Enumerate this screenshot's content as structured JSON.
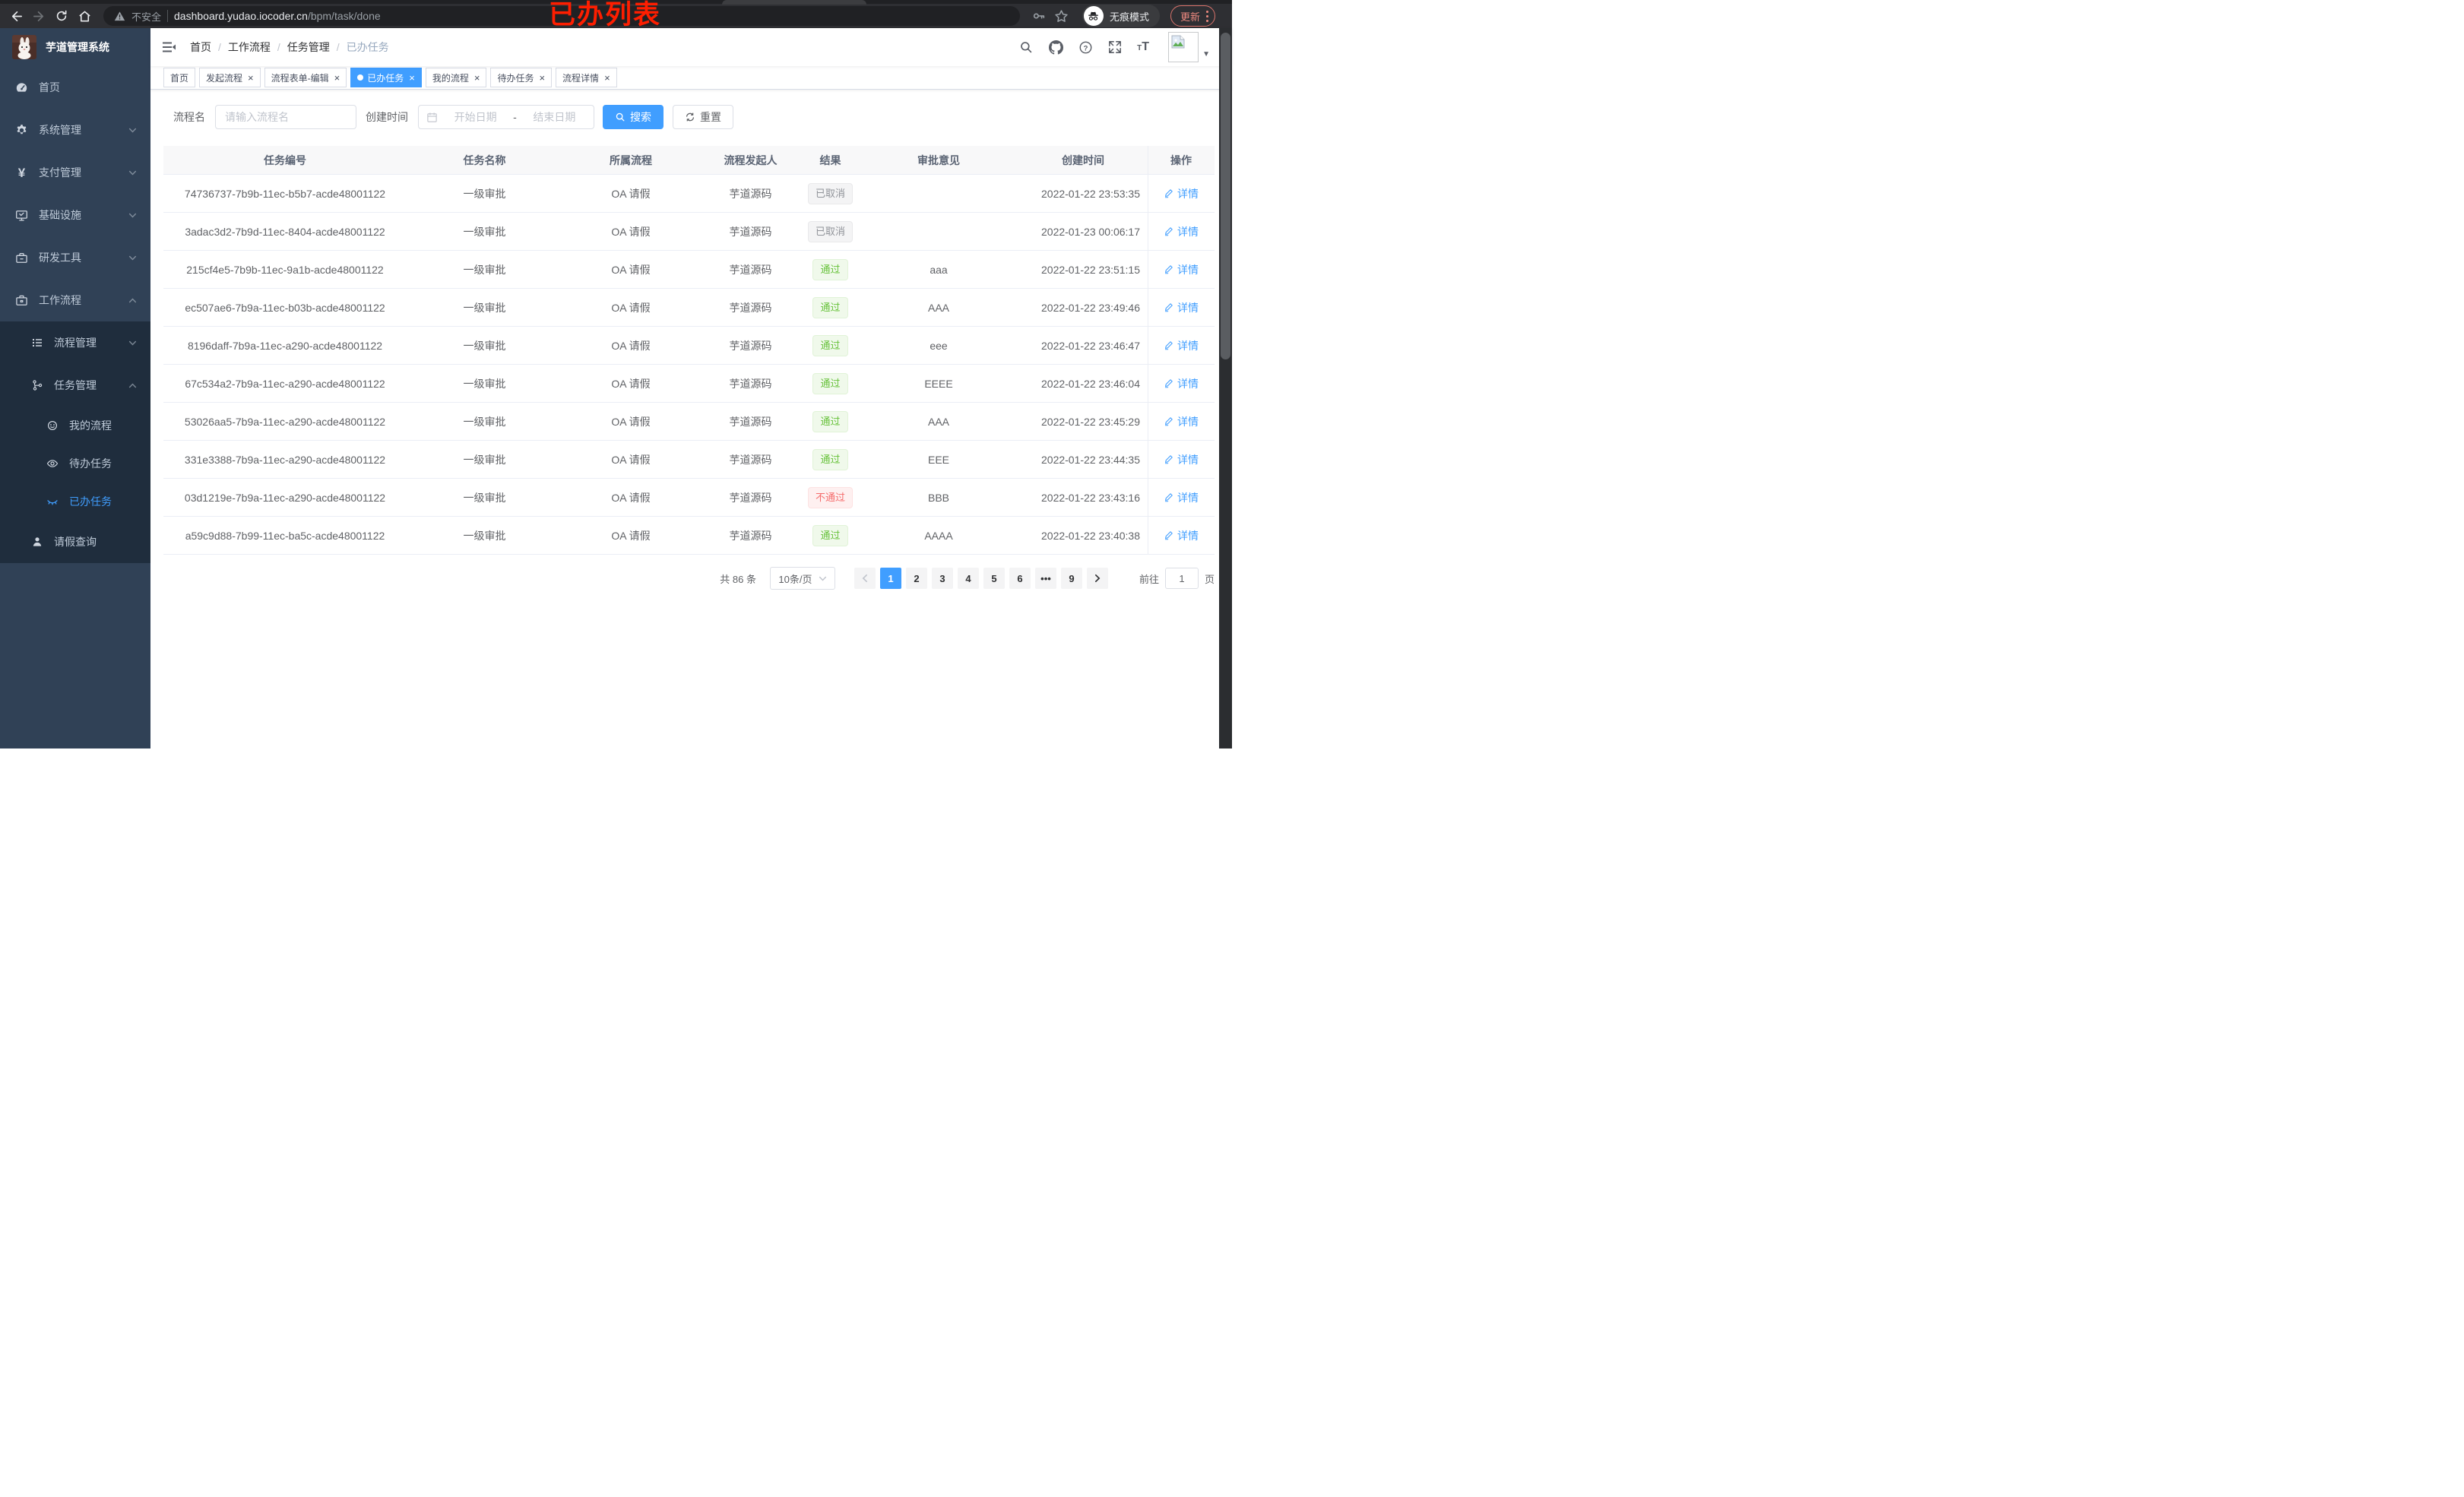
{
  "ui": {
    "close_glyph": "×",
    "breadcrumb_separator": "/",
    "caret_glyph": "▼"
  },
  "annotation": {
    "text": "已办列表"
  },
  "browser": {
    "security_label": "不安全",
    "url_host": "dashboard.yudao.iocoder.cn",
    "url_path": "/bpm/task/done",
    "incognito_label": "无痕模式",
    "update_label": "更新"
  },
  "sidebar": {
    "app_title": "芋道管理系统",
    "items": [
      {
        "label": "首页",
        "icon": "dashboard-icon"
      },
      {
        "label": "系统管理",
        "icon": "gear-icon"
      },
      {
        "label": "支付管理",
        "icon": "yen-icon"
      },
      {
        "label": "基础设施",
        "icon": "monitor-icon"
      },
      {
        "label": "研发工具",
        "icon": "toolbox-icon"
      },
      {
        "label": "工作流程",
        "icon": "briefcase-icon"
      }
    ],
    "submenu": [
      {
        "label": "流程管理",
        "icon": "list-icon"
      },
      {
        "label": "任务管理",
        "icon": "flow-icon"
      }
    ],
    "task_children": [
      {
        "label": "我的流程",
        "icon": "user-face-icon"
      },
      {
        "label": "待办任务",
        "icon": "eye-open-icon"
      },
      {
        "label": "已办任务",
        "icon": "eye-closed-icon",
        "active": true
      }
    ],
    "leave_query": {
      "label": "请假查询",
      "icon": "person-icon"
    }
  },
  "breadcrumb": {
    "items": [
      "首页",
      "工作流程",
      "任务管理",
      "已办任务"
    ]
  },
  "tabs": [
    {
      "label": "首页",
      "closable": false,
      "active": false
    },
    {
      "label": "发起流程",
      "closable": true,
      "active": false
    },
    {
      "label": "流程表单-编辑",
      "closable": true,
      "active": false
    },
    {
      "label": "已办任务",
      "closable": true,
      "active": true
    },
    {
      "label": "我的流程",
      "closable": true,
      "active": false
    },
    {
      "label": "待办任务",
      "closable": true,
      "active": false
    },
    {
      "label": "流程详情",
      "closable": true,
      "active": false
    }
  ],
  "filters": {
    "name_label": "流程名",
    "name_placeholder": "请输入流程名",
    "time_label": "创建时间",
    "start_placeholder": "开始日期",
    "range_separator": "-",
    "end_placeholder": "结束日期",
    "search_label": "搜索",
    "reset_label": "重置"
  },
  "table": {
    "columns": [
      "任务编号",
      "任务名称",
      "所属流程",
      "流程发起人",
      "结果",
      "审批意见",
      "创建时间",
      "操作"
    ],
    "detail_label": "详情",
    "rows": [
      {
        "id": "74736737-7b9b-11ec-b5b7-acde48001122",
        "name": "一级审批",
        "process": "OA 请假",
        "starter": "芋道源码",
        "result": "已取消",
        "result_type": "info",
        "comment": "",
        "created": "2022-01-22 23:53:35"
      },
      {
        "id": "3adac3d2-7b9d-11ec-8404-acde48001122",
        "name": "一级审批",
        "process": "OA 请假",
        "starter": "芋道源码",
        "result": "已取消",
        "result_type": "info",
        "comment": "",
        "created": "2022-01-23 00:06:17"
      },
      {
        "id": "215cf4e5-7b9b-11ec-9a1b-acde48001122",
        "name": "一级审批",
        "process": "OA 请假",
        "starter": "芋道源码",
        "result": "通过",
        "result_type": "success",
        "comment": "aaa",
        "created": "2022-01-22 23:51:15"
      },
      {
        "id": "ec507ae6-7b9a-11ec-b03b-acde48001122",
        "name": "一级审批",
        "process": "OA 请假",
        "starter": "芋道源码",
        "result": "通过",
        "result_type": "success",
        "comment": "AAA",
        "created": "2022-01-22 23:49:46"
      },
      {
        "id": "8196daff-7b9a-11ec-a290-acde48001122",
        "name": "一级审批",
        "process": "OA 请假",
        "starter": "芋道源码",
        "result": "通过",
        "result_type": "success",
        "comment": "eee",
        "created": "2022-01-22 23:46:47"
      },
      {
        "id": "67c534a2-7b9a-11ec-a290-acde48001122",
        "name": "一级审批",
        "process": "OA 请假",
        "starter": "芋道源码",
        "result": "通过",
        "result_type": "success",
        "comment": "EEEE",
        "created": "2022-01-22 23:46:04"
      },
      {
        "id": "53026aa5-7b9a-11ec-a290-acde48001122",
        "name": "一级审批",
        "process": "OA 请假",
        "starter": "芋道源码",
        "result": "通过",
        "result_type": "success",
        "comment": "AAA",
        "created": "2022-01-22 23:45:29"
      },
      {
        "id": "331e3388-7b9a-11ec-a290-acde48001122",
        "name": "一级审批",
        "process": "OA 请假",
        "starter": "芋道源码",
        "result": "通过",
        "result_type": "success",
        "comment": "EEE",
        "created": "2022-01-22 23:44:35"
      },
      {
        "id": "03d1219e-7b9a-11ec-a290-acde48001122",
        "name": "一级审批",
        "process": "OA 请假",
        "starter": "芋道源码",
        "result": "不通过",
        "result_type": "danger",
        "comment": "BBB",
        "created": "2022-01-22 23:43:16"
      },
      {
        "id": "a59c9d88-7b99-11ec-ba5c-acde48001122",
        "name": "一级审批",
        "process": "OA 请假",
        "starter": "芋道源码",
        "result": "通过",
        "result_type": "success",
        "comment": "AAAA",
        "created": "2022-01-22 23:40:38"
      }
    ]
  },
  "pagination": {
    "total_label": "共 86 条",
    "page_size": "10条/页",
    "pages": [
      "1",
      "2",
      "3",
      "4",
      "5",
      "6"
    ],
    "ellipsis": "•••",
    "last_page": "9",
    "active_page": "1",
    "goto_label": "前往",
    "goto_value": "1",
    "page_label": "页"
  }
}
